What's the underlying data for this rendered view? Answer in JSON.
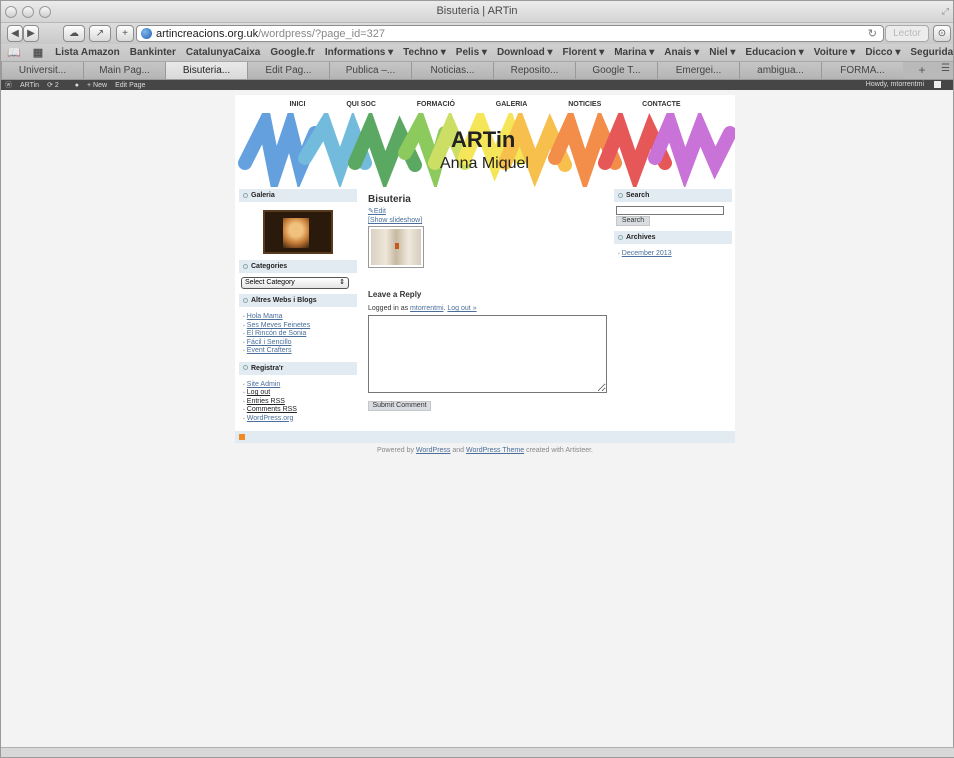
{
  "window": {
    "title": "Bisuteria | ARTin"
  },
  "toolbar": {
    "url_host": "artincreacions.org.uk",
    "url_path": "/wordpress/?page_id=327",
    "reader": "Lector"
  },
  "bookmarks": [
    "Lista Amazon",
    "Bankinter",
    "CatalunyaCaixa",
    "Google.fr",
    "Informations ▾",
    "Techno ▾",
    "Pelis ▾",
    "Download ▾",
    "Florent ▾",
    "Marina ▾",
    "Anais ▾",
    "Niel ▾",
    "Educacion ▾",
    "Voiture ▾",
    "Dicco ▾",
    "Seguridad IT ▾"
  ],
  "tabs": [
    "Universit...",
    "Main Pag...",
    "Bisuteria...",
    "Edit Pag...",
    "Publica –...",
    "Noticias...",
    "Reposito...",
    "Google T...",
    "Emergei...",
    "ambigua...",
    "FORMA..."
  ],
  "adminbar": {
    "site": "ARTin",
    "updates": "2",
    "new": "+ New",
    "edit": "Edit Page",
    "howdy": "Howdy, mtorrentmi"
  },
  "nav": [
    "INICI",
    "QUI SOC",
    "FORMACIÓ",
    "GALERIA",
    "NOTICIES",
    "CONTACTE"
  ],
  "header": {
    "title": "ARTin",
    "subtitle": "Anna Miquel"
  },
  "sidebar_left": {
    "galeria": "Galeria",
    "categories": "Categories",
    "select_category": "Select Category",
    "altres": "Altres Webs i Blogs",
    "altres_links": [
      "Hola Mama",
      "Ses Meves Feinetes",
      "El Rincón de Sonia",
      "Fácil i Sencillo",
      "Event Crafters"
    ],
    "registre": "Registra'r",
    "registre_links": [
      "Site Admin",
      "Log out",
      "Entries RSS",
      "Comments RSS",
      "WordPress.org"
    ]
  },
  "main": {
    "post_title": "Bisuteria",
    "edit": "Edit",
    "slideshow": "[Show slideshow]",
    "reply_title": "Leave a Reply",
    "logged_prefix": "Logged in as",
    "logged_user": "mtorrentmi",
    "logout": "Log out »",
    "submit": "Submit Comment"
  },
  "sidebar_right": {
    "search": "Search",
    "search_btn": "Search",
    "archives": "Archives",
    "archive_links": [
      "December 2013"
    ]
  },
  "footer": {
    "powered_prefix": "Powered by",
    "wordpress": "WordPress",
    "and": "and",
    "theme": "WordPress Theme",
    "suffix": "created with Artisteer."
  }
}
